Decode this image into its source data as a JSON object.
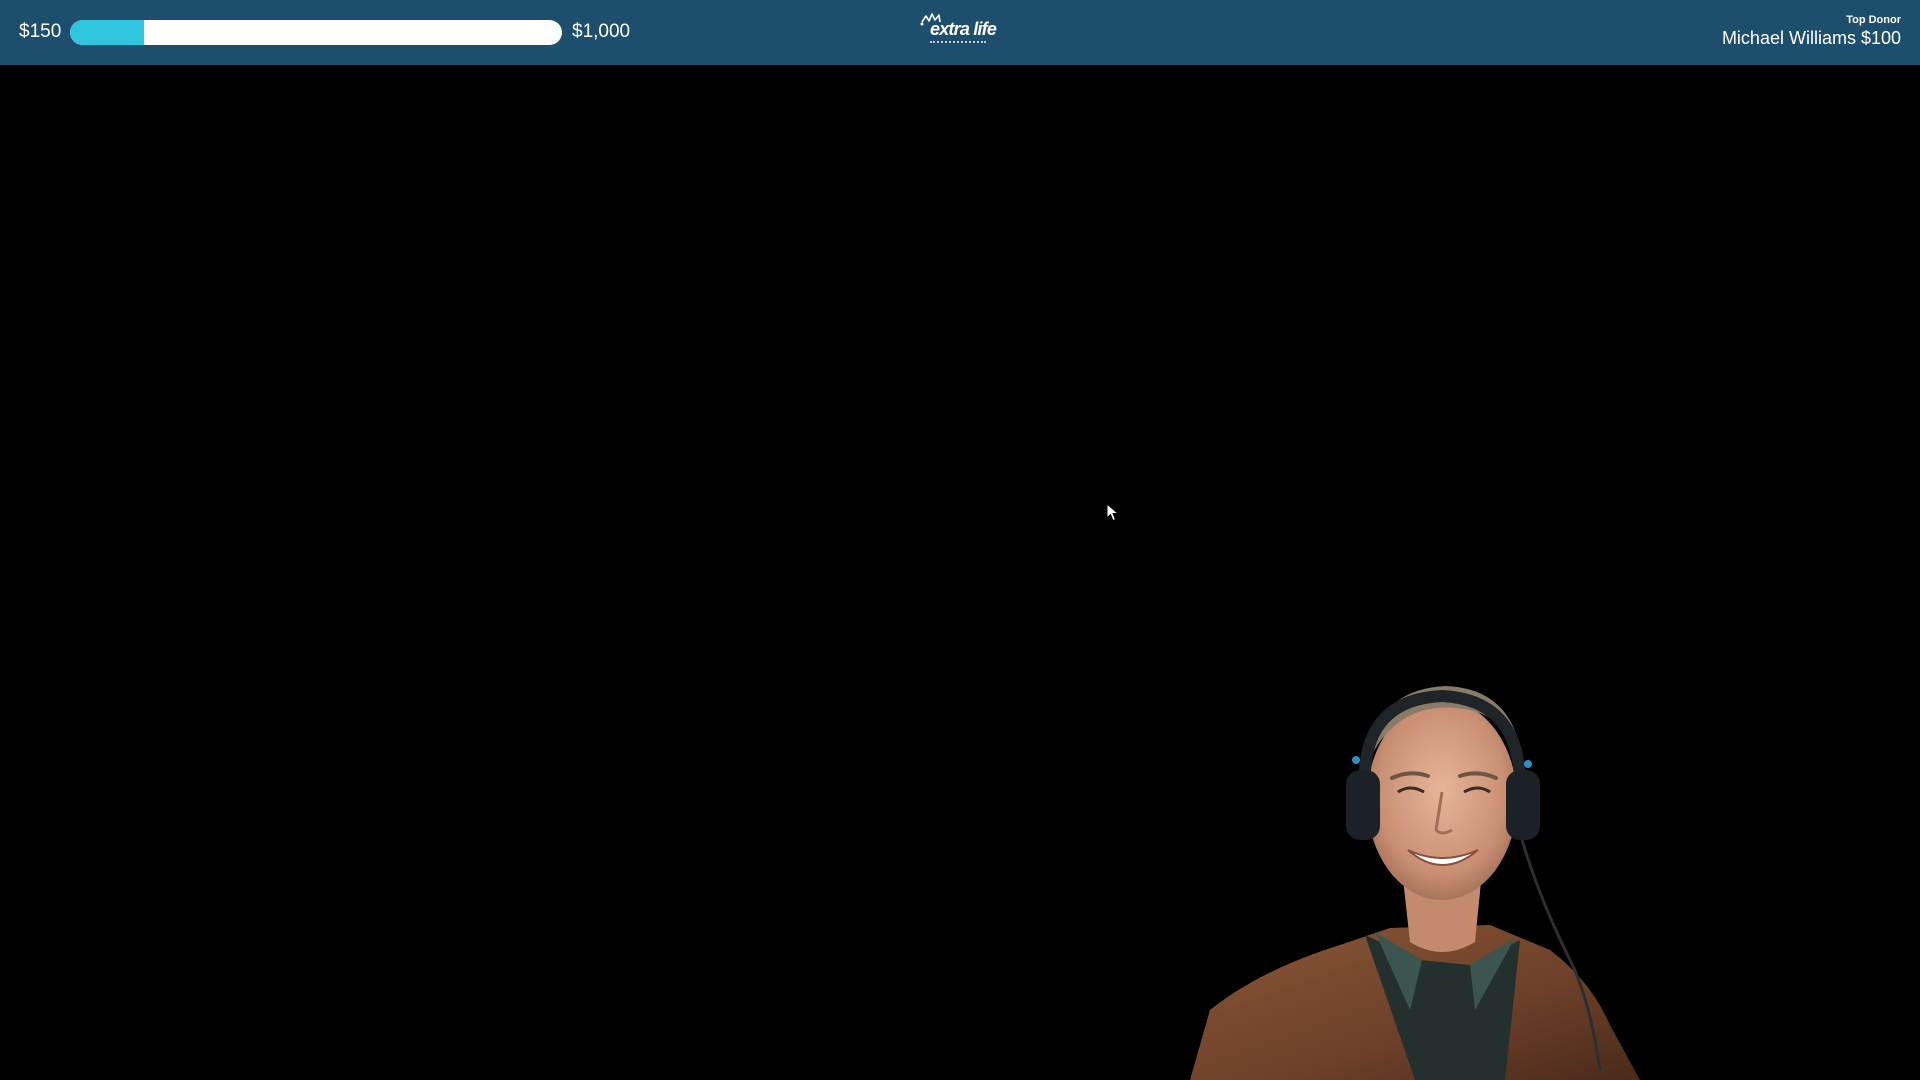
{
  "banner": {
    "goal_current": "$150",
    "goal_target": "$1,000",
    "progress_fraction": 0.15,
    "logo_text": "extra life",
    "top_donor_label": "Top Donor",
    "top_donor_value": "Michael Williams $100"
  },
  "colors": {
    "banner_background": "#1e4e6d",
    "progress_fill": "#2ec5dd",
    "progress_track": "#ffffff",
    "stage_background": "#000000"
  },
  "icons": {
    "cursor": "mouse-pointer-icon",
    "logo": "extra-life-logo"
  },
  "webcam": {
    "description_name": "streamer-webcam"
  }
}
